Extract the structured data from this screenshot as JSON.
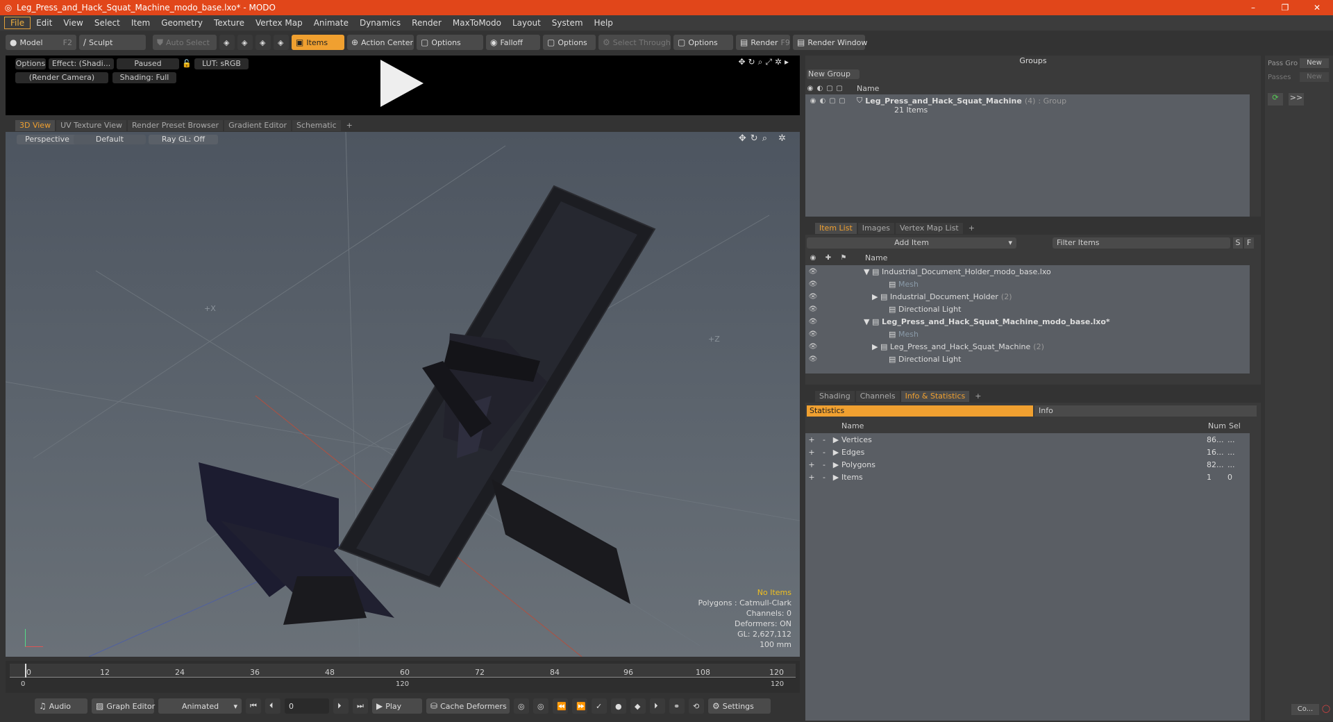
{
  "window": {
    "title": "Leg_Press_and_Hack_Squat_Machine_modo_base.lxo* - MODO",
    "min": "–",
    "max": "❐",
    "close": "✕"
  },
  "menu": [
    "File",
    "Edit",
    "View",
    "Select",
    "Item",
    "Geometry",
    "Texture",
    "Vertex Map",
    "Animate",
    "Dynamics",
    "Render",
    "MaxToModo",
    "Layout",
    "System",
    "Help"
  ],
  "toolbar": {
    "model": "Model",
    "model_key": "F2",
    "sculpt": "Sculpt",
    "auto_select": "Auto Select",
    "items": "Items",
    "action_center": "Action Center",
    "options1": "Options",
    "falloff": "Falloff",
    "options2": "Options",
    "select_through": "Select Through",
    "options3": "Options",
    "render": "Render",
    "render_key": "F9",
    "render_window": "Render Window"
  },
  "render_preview": {
    "options": "Options",
    "effect": "Effect: (Shadi...",
    "paused": "Paused",
    "lut": "LUT: sRGB",
    "camera": "(Render Camera)",
    "shading": "Shading: Full"
  },
  "view_tabs": [
    "3D View",
    "UV Texture View",
    "Render Preset Browser",
    "Gradient Editor",
    "Schematic",
    "+"
  ],
  "viewport": {
    "perspective": "Perspective",
    "default": "Default",
    "raygl": "Ray GL: Off",
    "axis_x": "+X",
    "axis_z": "+Z",
    "info": {
      "no_items": "No Items",
      "polygons": "Polygons : Catmull-Clark",
      "channels": "Channels: 0",
      "deformers": "Deformers: ON",
      "gl": "GL: 2,627,112",
      "units": "100 mm"
    }
  },
  "timeline": {
    "ticks": [
      "0",
      "12",
      "24",
      "36",
      "48",
      "60",
      "72",
      "84",
      "96",
      "108",
      "120"
    ],
    "start": "0",
    "mid": "120",
    "end": "120"
  },
  "bottom": {
    "audio": "Audio",
    "graph_editor": "Graph Editor",
    "animated": "Animated",
    "frame": "0",
    "play": "Play",
    "cache": "Cache Deformers",
    "settings": "Settings"
  },
  "groups": {
    "header": "Groups",
    "new_group": "New Group",
    "col_name": "Name",
    "item_name": "Leg_Press_and_Hack_Squat_Machine",
    "item_count": "(4)",
    "item_type": ": Group",
    "item_sub": "21 Items"
  },
  "item_list": {
    "tabs": [
      "Item List",
      "Images",
      "Vertex Map List",
      "+"
    ],
    "add_item": "Add Item",
    "filter": "Filter Items",
    "s": "S",
    "f": "F",
    "col_name": "Name",
    "rows": [
      {
        "indent": 0,
        "arrow": "▼",
        "label": "Industrial_Document_Holder_modo_base.lxo",
        "bold": false,
        "dim": false,
        "count": "",
        "eye": "👁"
      },
      {
        "indent": 2,
        "arrow": "",
        "label": "Mesh",
        "bold": false,
        "dim": true,
        "count": "",
        "eye": "👁"
      },
      {
        "indent": 1,
        "arrow": "▶",
        "label": "Industrial_Document_Holder",
        "bold": false,
        "dim": false,
        "count": "(2)",
        "eye": "👁"
      },
      {
        "indent": 2,
        "arrow": "",
        "label": "Directional Light",
        "bold": false,
        "dim": false,
        "count": "",
        "eye": "👁"
      },
      {
        "indent": 0,
        "arrow": "▼",
        "label": "Leg_Press_and_Hack_Squat_Machine_modo_base.lxo*",
        "bold": true,
        "dim": false,
        "count": "",
        "eye": "👁"
      },
      {
        "indent": 2,
        "arrow": "",
        "label": "Mesh",
        "bold": false,
        "dim": true,
        "count": "",
        "eye": "👁"
      },
      {
        "indent": 1,
        "arrow": "▶",
        "label": "Leg_Press_and_Hack_Squat_Machine",
        "bold": false,
        "dim": false,
        "count": "(2)",
        "eye": "👁"
      },
      {
        "indent": 2,
        "arrow": "",
        "label": "Directional Light",
        "bold": false,
        "dim": false,
        "count": "",
        "eye": "👁"
      }
    ]
  },
  "stats": {
    "tabs": [
      "Shading",
      "Channels",
      "Info & Statistics",
      "+"
    ],
    "statistics": "Statistics",
    "info": "Info",
    "col_name": "Name",
    "col_num": "Num",
    "col_sel": "Sel",
    "rows": [
      {
        "name": "Vertices",
        "num": "86...",
        "sel": "..."
      },
      {
        "name": "Edges",
        "num": "16...",
        "sel": "..."
      },
      {
        "name": "Polygons",
        "num": "82...",
        "sel": "..."
      },
      {
        "name": "Items",
        "num": "1",
        "sel": "0"
      }
    ]
  },
  "far_right": {
    "pass_group": "Pass Gro",
    "new1": "New",
    "passes": "Passes",
    "new2": "New",
    "more": ">>",
    "co": "Co..."
  }
}
